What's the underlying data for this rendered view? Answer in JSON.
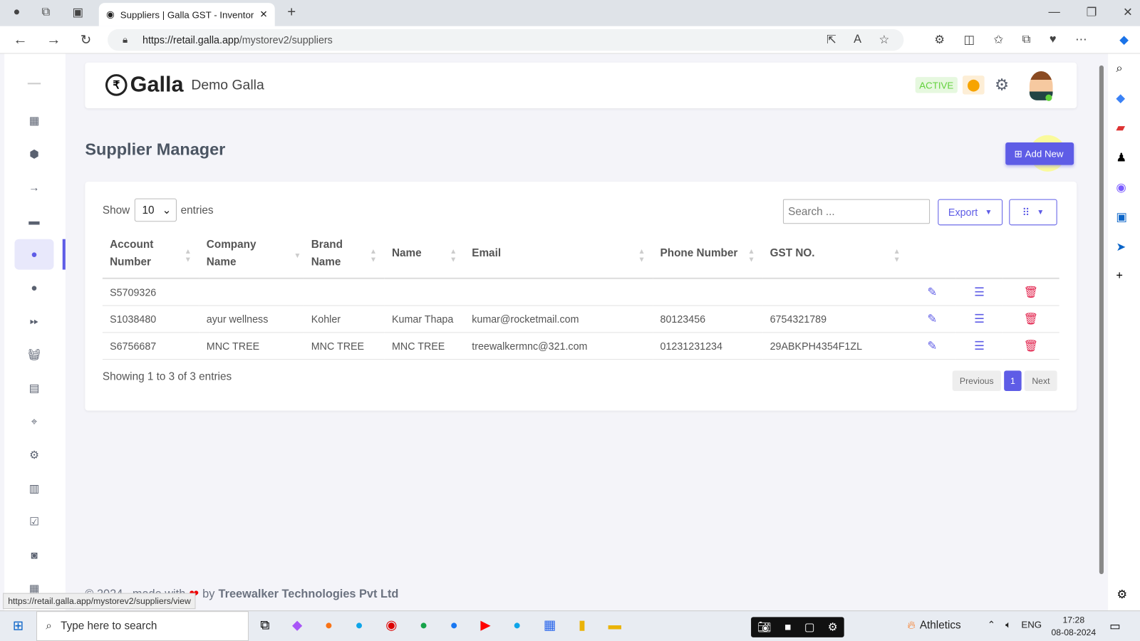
{
  "browser": {
    "tab_title": "Suppliers | Galla GST - Inventory",
    "url_host": "https://retail.galla.app",
    "url_path": "/mystorev2/suppliers",
    "status_url": "https://retail.galla.app/mystorev2/suppliers/view"
  },
  "header": {
    "logo": "Galla",
    "store": "Demo Galla",
    "status": "ACTIVE",
    "status_color": "#62d13c",
    "accent": "#5e5ce6"
  },
  "page": {
    "title": "Supplier Manager",
    "add_new": "Add New"
  },
  "table_controls": {
    "show": "Show",
    "entries_value": "10",
    "entries": "entries",
    "search_placeholder": "Search ...",
    "export": "Export"
  },
  "columns": [
    "Account Number",
    "Company Name",
    "Brand Name",
    "Name",
    "Email",
    "Phone Number",
    "GST NO."
  ],
  "rows": [
    [
      "S5709326",
      "",
      "",
      "",
      "",
      "",
      ""
    ],
    [
      "S1038480",
      "ayur wellness",
      "Kohler",
      "Kumar Thapa",
      "kumar@rocketmail.com",
      "80123456",
      "6754321789"
    ],
    [
      "S6756687",
      "MNC TREE",
      "MNC TREE",
      "MNC TREE",
      "treewalkermnc@321.com",
      "01231231234",
      "29ABKPH4354F1ZL"
    ]
  ],
  "footer": {
    "info": "Showing 1 to 3 of 3 entries",
    "prev": "Previous",
    "page": "1",
    "next": "Next",
    "copy": "© 2024 , made with",
    "by": "by",
    "company": "Treewalker Technologies Pvt Ltd"
  },
  "taskbar": {
    "search": "Type here to search",
    "weather": "Athletics",
    "lang": "ENG",
    "time": "17:28",
    "date": "08-08-2024"
  }
}
